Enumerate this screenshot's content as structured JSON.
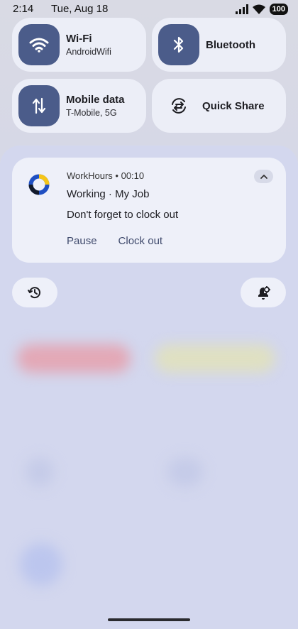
{
  "status": {
    "time": "2:14",
    "date": "Tue, Aug 18",
    "battery": "100"
  },
  "tiles": [
    {
      "label": "Wi-Fi",
      "sub": "AndroidWifi",
      "icon": "wifi-icon"
    },
    {
      "label": "Bluetooth",
      "sub": "",
      "icon": "bluetooth-icon"
    },
    {
      "label": "Mobile data",
      "sub": "T-Mobile, 5G",
      "icon": "mobile-data-icon"
    },
    {
      "label": "Quick Share",
      "sub": "",
      "icon": "quick-share-icon"
    }
  ],
  "notification": {
    "app": "WorkHours",
    "elapsed": "00:10",
    "separator": "•",
    "title": "Working · My Job",
    "text": "Don't forget to clock out",
    "actions": [
      "Pause",
      "Clock out"
    ]
  },
  "colors": {
    "accent": "#4b5c8a",
    "shade": "#d3d7ee",
    "card": "#eef0f9",
    "app_icon_blue": "#1f4fc2",
    "app_icon_yellow": "#f5c518"
  }
}
